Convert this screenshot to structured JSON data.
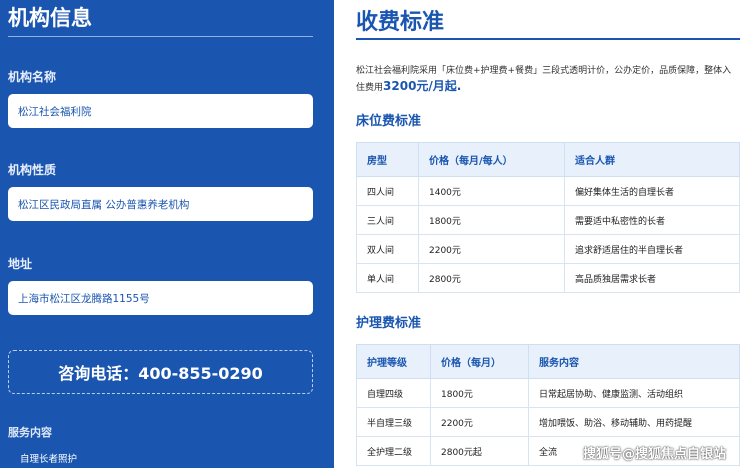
{
  "left": {
    "title": "机构信息",
    "fields": [
      {
        "label": "机构名称",
        "value": "松江社会福利院"
      },
      {
        "label": "机构性质",
        "value": "松江区民政局直属 公办普惠养老机构"
      },
      {
        "label": "地址",
        "value": "上海市松江区龙腾路1155号"
      }
    ],
    "phone": "咨询电话：400-855-0290",
    "services_label": "服务内容",
    "services_first": "自理长者照护"
  },
  "right": {
    "title": "收费标准",
    "intro_text": "松江社会福利院采用「床位费+护理费+餐费」三段式透明计价，公办定价，品质保障，整体入住费用",
    "intro_price": "3200元/月起.",
    "bed": {
      "title": "床位费标准",
      "headers": [
        "房型",
        "价格（每月/每人）",
        "适合人群"
      ],
      "rows": [
        [
          "四人间",
          "1400元",
          "偏好集体生活的自理长者"
        ],
        [
          "三人间",
          "1800元",
          "需要适中私密性的长者"
        ],
        [
          "双人间",
          "2200元",
          "追求舒适居住的半自理长者"
        ],
        [
          "单人间",
          "2800元",
          "高品质独居需求长者"
        ]
      ]
    },
    "care": {
      "title": "护理费标准",
      "headers": [
        "护理等级",
        "价格（每月）",
        "服务内容"
      ],
      "rows": [
        [
          "自理四级",
          "1800元",
          "日常起居协助、健康监测、活动组织"
        ],
        [
          "半自理三级",
          "2200元",
          "增加喂饭、助浴、移动辅助、用药提醒"
        ],
        [
          "全护理二级",
          "2800元起",
          "全流"
        ]
      ]
    }
  },
  "watermark": "搜狐号@搜狐焦点自银站"
}
